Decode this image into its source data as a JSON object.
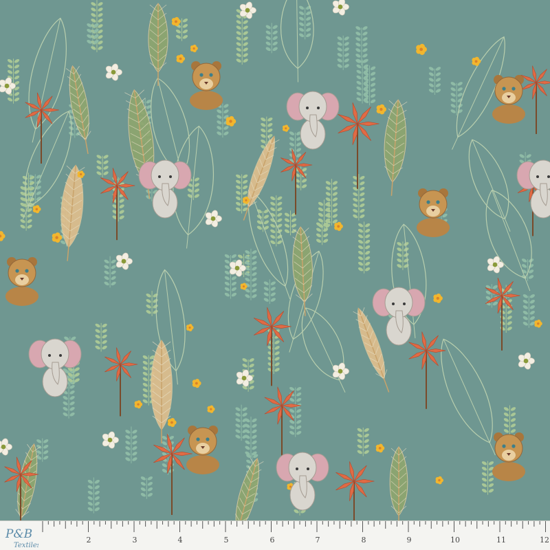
{
  "fabric": {
    "background": "#6f9791",
    "motifs": [
      "lion-cub",
      "baby-elephant",
      "palm-leaf",
      "banana-leaf",
      "fern",
      "daisy",
      "protea-flower",
      "small-yellow-flower"
    ]
  },
  "ruler": {
    "numbers": [
      "2",
      "3",
      "4",
      "5",
      "6",
      "7",
      "8",
      "9",
      "10",
      "11",
      "12"
    ]
  },
  "logo": {
    "text": "P&B",
    "subtext": "Textiles"
  },
  "colors": {
    "leaf_green": "#8fa66e",
    "leaf_tan": "#e2c08d",
    "coral": "#e06b45",
    "yellow": "#f2b62e",
    "cream": "#f3eee2",
    "elephant": "#d9d6cf",
    "lion": "#c79552"
  }
}
